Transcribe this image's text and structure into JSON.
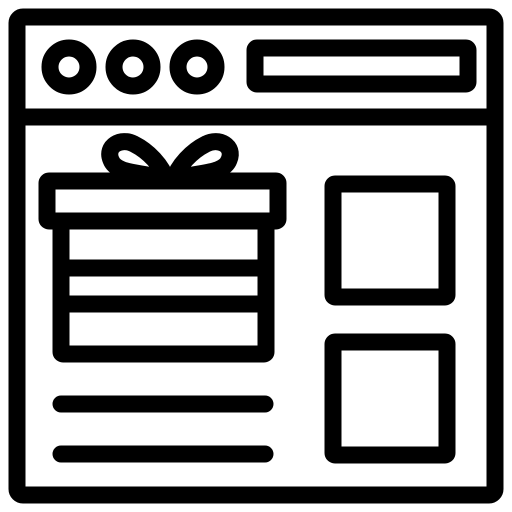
{
  "icon": {
    "name": "browser-window-gift-icon",
    "stroke_color": "#000000",
    "fill_color": "#ffffff"
  },
  "window_controls": [
    {
      "name": "window-control-dot-1"
    },
    {
      "name": "window-control-dot-2"
    },
    {
      "name": "window-control-dot-3"
    }
  ],
  "address_bar": {
    "value": ""
  },
  "content": {
    "gift_box": {
      "name": "gift-icon"
    },
    "text_lines_count": 2,
    "thumbnails_count": 2
  }
}
